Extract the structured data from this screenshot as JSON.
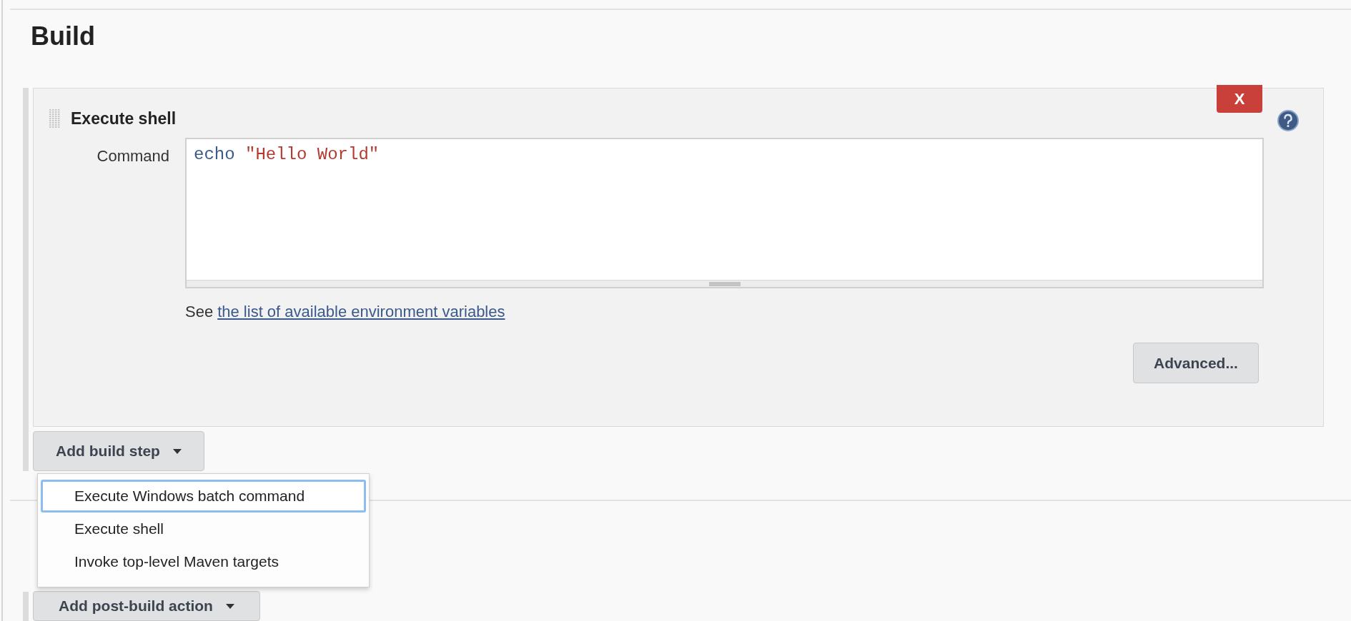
{
  "section": {
    "title": "Build"
  },
  "build_step": {
    "title": "Execute shell",
    "delete_label": "X",
    "field_label": "Command",
    "command": [
      {
        "text": "echo",
        "kind": "keyword"
      },
      {
        "text": "\"Hello World\"",
        "kind": "string"
      }
    ],
    "hint_prefix": "See",
    "hint_link": "the list of available environment variables",
    "advanced_button": "Advanced..."
  },
  "add_build_step": {
    "label": "Add build step",
    "menu": [
      {
        "label": "Execute Windows batch command",
        "selected": true
      },
      {
        "label": "Execute shell",
        "selected": false
      },
      {
        "label": "Invoke top-level Maven targets",
        "selected": false
      }
    ]
  },
  "add_post_build": {
    "label": "Add post-build action"
  }
}
